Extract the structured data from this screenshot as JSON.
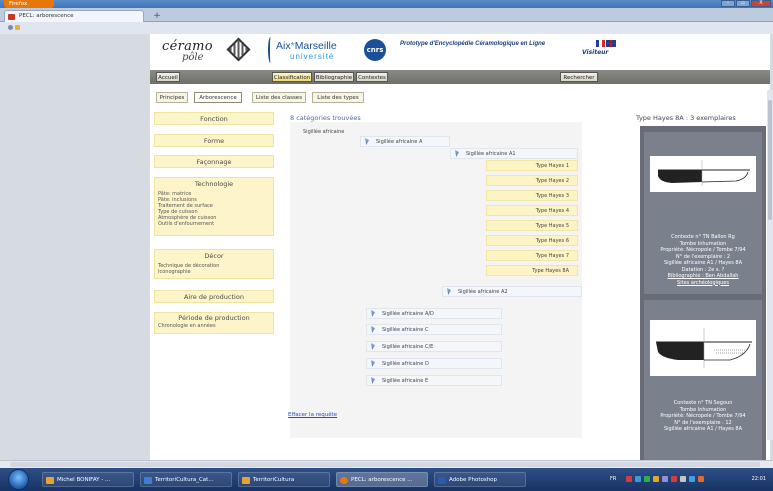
{
  "browser": {
    "menu_button": "Firefox",
    "tab_title": "PECL: arborescence",
    "new_tab": "+",
    "window_controls": [
      "–",
      "▫",
      "X"
    ]
  },
  "site": {
    "logo_ceramo_line1": "céramo",
    "logo_ceramo_line2": "pôle",
    "amu_line1_a": "Aix",
    "amu_line1_b": "*",
    "amu_line1_c": "Marseille",
    "amu_line2": "université",
    "cnrs": "cnrs",
    "prototype_title": "Prototype d'Encyclopédie Céramologique en Ligne",
    "user_role": "Visiteur"
  },
  "menu": {
    "accueil": "Accueil",
    "classification": "Classification",
    "bibliographie": "Bibliographie",
    "contextes": "Contextes",
    "rechercher": "Rechercher"
  },
  "subnav": {
    "principes": "Principes",
    "arborescence": "Arborescence",
    "liste_classes": "Liste des classes",
    "liste_types": "Liste des types"
  },
  "facets": [
    {
      "title": "Fonction",
      "items": []
    },
    {
      "title": "Forme",
      "items": []
    },
    {
      "title": "Façonnage",
      "items": []
    },
    {
      "title": "Technologie",
      "items": [
        "Pâte: matrice",
        "Pâte: inclusions",
        "Traitement de surface",
        "Type de cuisson",
        "Atmosphère de cuisson",
        "Outils d'enfournement"
      ]
    },
    {
      "title": "Décor",
      "items": [
        "Technique de décoration",
        "Iconographie"
      ]
    },
    {
      "title": "Aire de production",
      "items": []
    },
    {
      "title": "Période de production",
      "items": [
        "Chronologie en années"
      ]
    }
  ],
  "results": {
    "count_label": "8 catégories trouvées",
    "root": "Sigillée africaine",
    "a": "Sigillée africaine A",
    "a1": "Sigillée africaine A1",
    "types": [
      "Type Hayes 1",
      "Type Hayes 2",
      "Type Hayes 3",
      "Type Hayes 4",
      "Type Hayes 5",
      "Type Hayes 6",
      "Type Hayes 7",
      "Type Hayes 8A"
    ],
    "a2": "Sigillée africaine A2",
    "others": [
      "Sigillée africaine A/D",
      "Sigillée africaine C",
      "Sigillée africaine C/E",
      "Sigillée africaine D",
      "Sigillée africaine E"
    ],
    "clear_link": "Effacer la requête"
  },
  "right_panel": {
    "title": "Type Hayes 8A : 3 exemplaires",
    "card1": [
      "Contexte n° TN Ballon Rg",
      "Tombe Inhumation",
      "Propriété: Nécropole / Tombe 7/94",
      "N° de l'exemplaire : 2",
      "Sigillée africaine A1 / Hayes 8A",
      "Datation : 2e s. ?",
      "Bibliographie : Ben Abdallah",
      "Sites archéologiques"
    ],
    "card2": [
      "Contexte n° TN Segoun",
      "Tombe Inhumation",
      "Propriété: Nécropole / Tombe 7/94",
      "N° de l'exemplaire : 12",
      "Sigillée africaine A1 / Hayes 8A"
    ]
  },
  "taskbar": {
    "tasks": [
      "Michel BONIFAY - ...",
      "TerritoriCultura_Cat...",
      "TerritoriCultura",
      "PECL: arborescence ...",
      "Adobe Photoshop"
    ],
    "tray_lang": "FR",
    "clock": "22:01"
  },
  "colors": {
    "facet_bg": "#fdf5c9",
    "type_bg": "#fdf4c4",
    "menu_active": "#f1d97a",
    "panel_bg": "#676c76",
    "link": "#2a50b8"
  }
}
